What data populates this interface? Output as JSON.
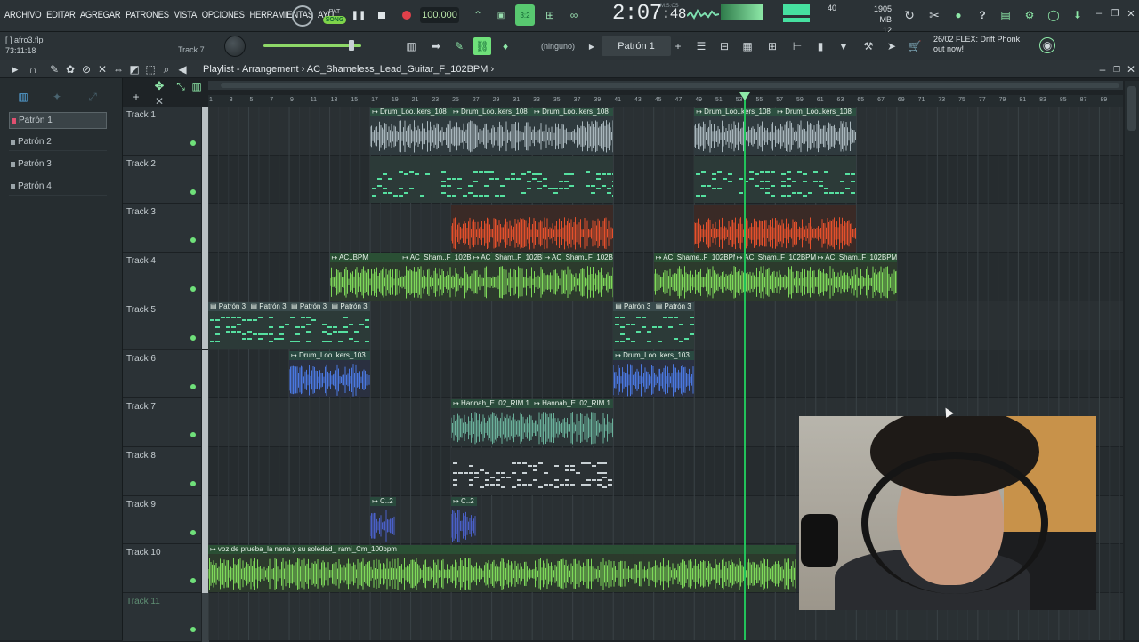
{
  "menu": [
    "ARCHIVO",
    "EDITAR",
    "AGREGAR",
    "PATRONES",
    "VISTA",
    "OPCIONES",
    "HERRAMIENTAS",
    "AYU"
  ],
  "transport": {
    "pat_label": "PAT",
    "song_label": "SONG",
    "tempo": "100.000",
    "time_main": "2:07",
    "time_sub": "48",
    "time_unit": "M:S:CS"
  },
  "monitor": {
    "cpu": "40",
    "memory": "1905 MB",
    "polyphony": "12"
  },
  "file": {
    "name": "afro3.flp",
    "elapsed": "73:11:18"
  },
  "toolbar2": {
    "track_hint": "Track 7",
    "snap": "(ninguno)",
    "pattern_selector": "Patrón 1"
  },
  "news": {
    "date": "26/02",
    "text": "FLEX: Drift Phonk",
    "sub": "out now!"
  },
  "playlist": {
    "title": "Playlist - Arrangement",
    "breadcrumb_sep": "›",
    "arrangement": "AC_Shameless_Lead_Guitar_F_102BPM"
  },
  "patterns": [
    "Patrón 1",
    "Patrón 2",
    "Patrón 3",
    "Patrón 4"
  ],
  "tracks": [
    "Track 1",
    "Track 2",
    "Track 3",
    "Track 4",
    "Track 5",
    "Track 6",
    "Track 7",
    "Track 8",
    "Track 9",
    "Track 10",
    "Track 11"
  ],
  "ruler_marks": [
    "1",
    "3",
    "5",
    "7",
    "9",
    "11",
    "13",
    "15",
    "17",
    "19",
    "21",
    "23",
    "25",
    "27",
    "29",
    "31",
    "33",
    "35",
    "37",
    "39",
    "41",
    "43",
    "45",
    "47",
    "49",
    "51",
    "53",
    "55",
    "57",
    "59",
    "61",
    "63",
    "65",
    "67",
    "69",
    "71",
    "73",
    "75",
    "77",
    "79",
    "81",
    "83",
    "85",
    "87",
    "89"
  ],
  "clips": [
    {
      "track": 0,
      "start": 17,
      "end": 41,
      "type": "audio",
      "color": "#a8b6bc",
      "bg": "#2f3a3e",
      "titles": [
        "Drum_Loo..kers_108",
        "Drum_Loo..kers_108",
        "Drum_Loo..kers_108"
      ]
    },
    {
      "track": 0,
      "start": 49,
      "end": 65,
      "type": "audio",
      "color": "#a8b6bc",
      "bg": "#2f3a3e",
      "titles": [
        "Drum_Loo..kers_108",
        "Drum_Loo..kers_108"
      ]
    },
    {
      "track": 1,
      "start": 17,
      "end": 41,
      "type": "pattern",
      "color": "#56e0a0",
      "bg": "#2c3a38",
      "titles": []
    },
    {
      "track": 1,
      "start": 49,
      "end": 65,
      "type": "pattern",
      "color": "#56e0a0",
      "bg": "#2c3a38",
      "titles": []
    },
    {
      "track": 2,
      "start": 25,
      "end": 41,
      "type": "audio",
      "color": "#e4502c",
      "bg": "#3a2a26",
      "titles": []
    },
    {
      "track": 2,
      "start": 49,
      "end": 65,
      "type": "audio",
      "color": "#e4502c",
      "bg": "#3a2a26",
      "titles": []
    },
    {
      "track": 3,
      "start": 13,
      "end": 41,
      "type": "audio",
      "color": "#7ed85a",
      "bg": "#2c3a2c",
      "titles": [
        "AC..BPM",
        "AC_Sham..F_102BPM",
        "AC_Sham..F_102BPM",
        "AC_Sham..F_102BPM"
      ]
    },
    {
      "track": 3,
      "start": 45,
      "end": 69,
      "type": "audio",
      "color": "#7ed85a",
      "bg": "#2c3a2c",
      "titles": [
        "AC_Shame..F_102BPM",
        "AC_Sham..F_102BPM",
        "AC_Sham..F_102BPM"
      ]
    },
    {
      "track": 4,
      "start": 1,
      "end": 17,
      "type": "pattern",
      "color": "#56e0a0",
      "bg": "#2c3a38",
      "titles": [
        "Patrón 3",
        "Patrón 3",
        "Patrón 3",
        "Patrón 3"
      ]
    },
    {
      "track": 4,
      "start": 41,
      "end": 49,
      "type": "pattern",
      "color": "#56e0a0",
      "bg": "#2c3a38",
      "titles": [
        "Patrón 3",
        "Patrón 3"
      ]
    },
    {
      "track": 5,
      "start": 9,
      "end": 17,
      "type": "audio",
      "color": "#4a78e0",
      "bg": "#2a3040",
      "titles": [
        "Drum_Loo..kers_103"
      ]
    },
    {
      "track": 5,
      "start": 41,
      "end": 49,
      "type": "audio",
      "color": "#4a78e0",
      "bg": "#2a3040",
      "titles": [
        "Drum_Loo..kers_103"
      ]
    },
    {
      "track": 6,
      "start": 25,
      "end": 41,
      "type": "audio",
      "color": "#6ab09a",
      "bg": "#2b3436",
      "titles": [
        "Hannah_E..02_RIM 1",
        "Hannah_E..02_RIM 1"
      ]
    },
    {
      "track": 7,
      "start": 25,
      "end": 41,
      "type": "pattern",
      "color": "#c8d0d4",
      "bg": "#2b3134",
      "titles": []
    },
    {
      "track": 8,
      "start": 17,
      "end": 19.5,
      "type": "audio",
      "color": "#4a60c8",
      "bg": "#2a3038",
      "titles": [
        "C..2"
      ]
    },
    {
      "track": 8,
      "start": 25,
      "end": 27.5,
      "type": "audio",
      "color": "#4a60c8",
      "bg": "#2a3038",
      "titles": [
        "C..2"
      ]
    },
    {
      "track": 9,
      "start": 1,
      "end": 59,
      "type": "audio",
      "color": "#7ed85a",
      "bg": "#2c3a2c",
      "titles": [
        "voz de prueba_la nena y su soledad_ rami_Cm_100bpm"
      ]
    }
  ]
}
